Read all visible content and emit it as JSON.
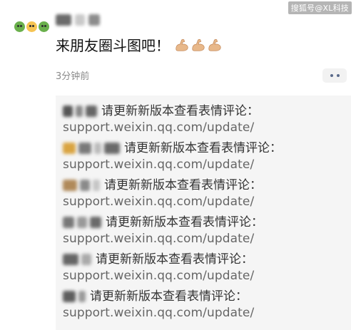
{
  "watermark": "搜狐号@XL科技",
  "post": {
    "text": "来朋友圈斗图吧！",
    "emoji": [
      "flexed-biceps-icon",
      "flexed-biceps-icon",
      "flexed-biceps-icon"
    ],
    "time": "3分钟前"
  },
  "comments": [
    {
      "text": "请更新新版本查看表情评论：",
      "link": "support.weixin.qq.com/update/"
    },
    {
      "text": "请更新新版本查看表情评论：",
      "link": "support.weixin.qq.com/update/"
    },
    {
      "text": "请更新新版本查看表情评论：",
      "link": "support.weixin.qq.com/update/"
    },
    {
      "text": "请更新新版本查看表情评论：",
      "link": "support.weixin.qq.com/update/"
    },
    {
      "text": "请更新新版本查看表情评论：",
      "link": "support.weixin.qq.com/update/"
    },
    {
      "text": "请更新新版本查看表情评论：",
      "link": "support.weixin.qq.com/update/"
    }
  ],
  "colors": {
    "comment_bg": "#f5f5f5",
    "time": "#8a8a8a",
    "more_dots": "#5a6a8a"
  }
}
